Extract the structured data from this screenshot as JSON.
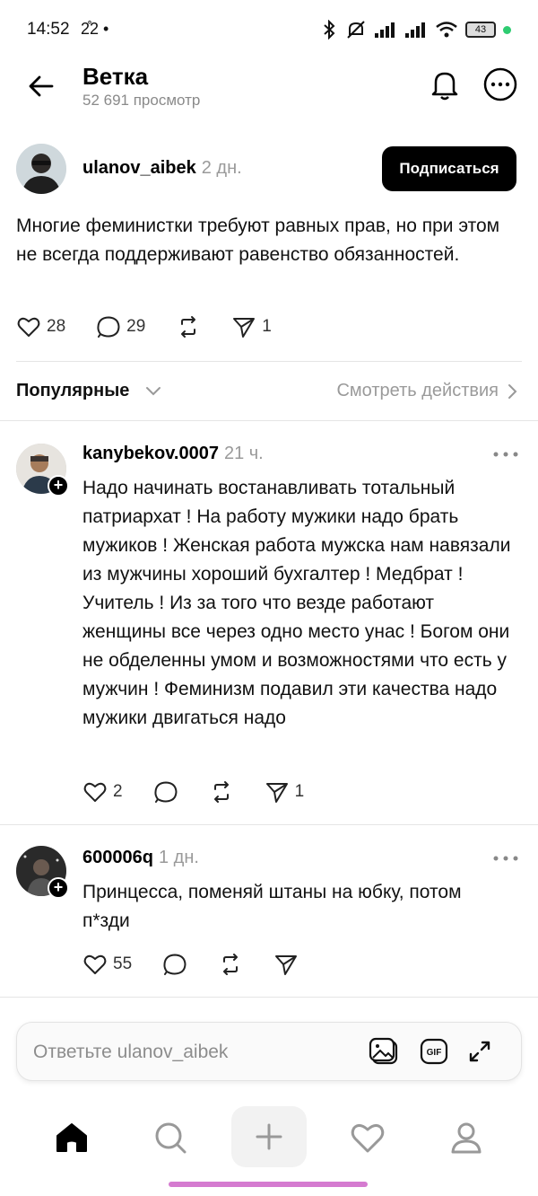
{
  "status_bar": {
    "time": "14:52",
    "extra": "2̊2 •",
    "battery": "43",
    "icons": [
      "bluetooth-icon",
      "mute-icon",
      "signal-icon",
      "signal-icon",
      "wifi-icon",
      "battery-icon"
    ]
  },
  "header": {
    "title": "Ветка",
    "views": "52 691 просмотр",
    "icons": [
      "back-arrow-icon",
      "bell-icon",
      "more-icon"
    ]
  },
  "post": {
    "author": "ulanov_aibek",
    "time": "2 дн.",
    "follow_label": "Подписаться",
    "text": "Многие феминистки требуют равных прав, но при этом не всегда поддерживают равенство обязанностей.",
    "likes": "28",
    "replies": "29",
    "shares": "1"
  },
  "sort": {
    "label": "Популярные",
    "view_actions": "Смотреть действия"
  },
  "replies": [
    {
      "author": "kanybekov.0007",
      "time": "21 ч.",
      "text": "Надо начинать востанавливать тотальный патриархат ! На работу мужики надо брать мужиков ! Женская работа мужска нам навязали из мужчины хороший бухгалтер ! Медбрат ! Учитель ! Из за того что везде работают женщины все через одно место унас ! Богом они не обделенны умом и возможностями что есть у мужчин ! Феминизм подавил эти качества надо мужики двигаться надо",
      "likes": "2",
      "shares": "1"
    },
    {
      "author": "600006q",
      "time": "1 дн.",
      "text": "Принцесса, поменяй штаны на юбку, потом п*зди",
      "likes": "55"
    }
  ],
  "reply_input": {
    "placeholder": "Ответьте ulanov_aibek"
  },
  "bottom_nav": [
    "home-icon",
    "search-icon",
    "plus-icon",
    "heart-icon",
    "profile-icon"
  ],
  "colors": {
    "accent": "#000000",
    "muted": "#8a8a8a",
    "home_indicator": "#d57bd0",
    "status_dot": "#2ecc71"
  }
}
